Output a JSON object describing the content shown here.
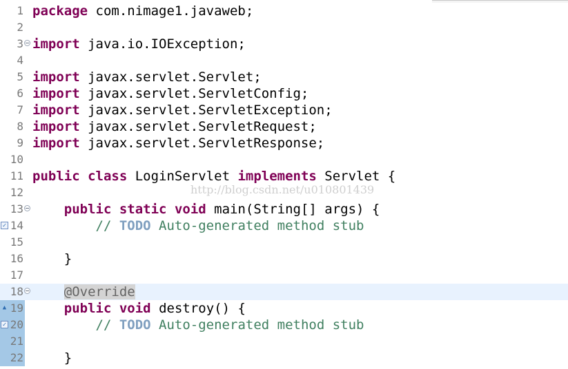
{
  "editor": {
    "lines": [
      {
        "num": "1",
        "segments": [
          {
            "t": "package",
            "c": "kw"
          },
          {
            "t": " com.nimage1.javaweb;",
            "c": "plain"
          }
        ]
      },
      {
        "num": "2",
        "segments": []
      },
      {
        "num": "3",
        "fold": true,
        "segments": [
          {
            "t": "import",
            "c": "kw"
          },
          {
            "t": " java.io.IOException;",
            "c": "plain"
          }
        ]
      },
      {
        "num": "4",
        "segments": []
      },
      {
        "num": "5",
        "segments": [
          {
            "t": "import",
            "c": "kw"
          },
          {
            "t": " javax.servlet.Servlet;",
            "c": "plain"
          }
        ]
      },
      {
        "num": "6",
        "segments": [
          {
            "t": "import",
            "c": "kw"
          },
          {
            "t": " javax.servlet.ServletConfig;",
            "c": "plain"
          }
        ]
      },
      {
        "num": "7",
        "segments": [
          {
            "t": "import",
            "c": "kw"
          },
          {
            "t": " javax.servlet.ServletException;",
            "c": "plain"
          }
        ]
      },
      {
        "num": "8",
        "segments": [
          {
            "t": "import",
            "c": "kw"
          },
          {
            "t": " javax.servlet.ServletRequest;",
            "c": "plain"
          }
        ]
      },
      {
        "num": "9",
        "segments": [
          {
            "t": "import",
            "c": "kw"
          },
          {
            "t": " javax.servlet.ServletResponse;",
            "c": "plain"
          }
        ]
      },
      {
        "num": "10",
        "segments": []
      },
      {
        "num": "11",
        "segments": [
          {
            "t": "public",
            "c": "kw"
          },
          {
            "t": " ",
            "c": "plain"
          },
          {
            "t": "class",
            "c": "kw"
          },
          {
            "t": " LoginServlet ",
            "c": "plain"
          },
          {
            "t": "implements",
            "c": "kw"
          },
          {
            "t": " Servlet {",
            "c": "plain"
          }
        ]
      },
      {
        "num": "12",
        "segments": []
      },
      {
        "num": "13",
        "fold": true,
        "segments": [
          {
            "t": "    ",
            "c": "plain"
          },
          {
            "t": "public",
            "c": "kw"
          },
          {
            "t": " ",
            "c": "plain"
          },
          {
            "t": "static",
            "c": "kw"
          },
          {
            "t": " ",
            "c": "plain"
          },
          {
            "t": "void",
            "c": "kw"
          },
          {
            "t": " main(String[] args) {",
            "c": "plain"
          }
        ]
      },
      {
        "num": "14",
        "marker": "task",
        "segments": [
          {
            "t": "        ",
            "c": "plain"
          },
          {
            "t": "// ",
            "c": "cm"
          },
          {
            "t": "TODO",
            "c": "todo"
          },
          {
            "t": " Auto-generated method stub",
            "c": "cm"
          }
        ]
      },
      {
        "num": "15",
        "segments": []
      },
      {
        "num": "16",
        "segments": [
          {
            "t": "    }",
            "c": "plain"
          }
        ]
      },
      {
        "num": "17",
        "segments": []
      },
      {
        "num": "18",
        "fold": true,
        "current": true,
        "segments": [
          {
            "t": "    ",
            "c": "plain"
          },
          {
            "t": "@Override",
            "c": "ann"
          }
        ]
      },
      {
        "num": "19",
        "marker": "override",
        "segments": [
          {
            "t": "    ",
            "c": "plain"
          },
          {
            "t": "public",
            "c": "kw"
          },
          {
            "t": " ",
            "c": "plain"
          },
          {
            "t": "void",
            "c": "kw"
          },
          {
            "t": " destroy() {",
            "c": "plain"
          }
        ]
      },
      {
        "num": "20",
        "marker": "task",
        "segments": [
          {
            "t": "        ",
            "c": "plain"
          },
          {
            "t": "// ",
            "c": "cm"
          },
          {
            "t": "TODO",
            "c": "todo"
          },
          {
            "t": " Auto-generated method stub",
            "c": "cm"
          }
        ]
      },
      {
        "num": "21",
        "segments": []
      },
      {
        "num": "22",
        "segments": [
          {
            "t": "    }",
            "c": "plain"
          }
        ]
      }
    ],
    "gutter_highlight_from": "18"
  },
  "watermark": "http://blog.csdn.net/u010801439",
  "colors": {
    "keyword": "#7f0055",
    "comment": "#3f7f5f",
    "todo": "#7f9fbf",
    "annotation": "#646464",
    "current_line": "#e8f2fe",
    "gutter_highlight": "#a4c8e6"
  },
  "icons": {
    "fold": "fold-collapse-icon",
    "task": "task-marker-icon",
    "override": "override-marker-icon"
  }
}
